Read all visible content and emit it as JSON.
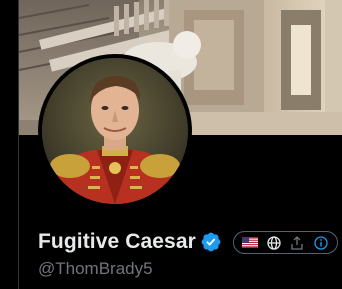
{
  "profile": {
    "display_name": "Fugitive Caesar",
    "handle": "@ThomBrady5",
    "verified": true,
    "verified_badge_color": "#1d9bf0"
  },
  "header_actions": [
    {
      "icon": "us-flag-icon"
    },
    {
      "icon": "globe-icon"
    },
    {
      "icon": "share-icon"
    },
    {
      "icon": "info-icon"
    }
  ],
  "colors": {
    "background": "#000000",
    "name_text": "#e7e9ea",
    "handle_text": "#71767b",
    "accent": "#1d9bf0"
  }
}
